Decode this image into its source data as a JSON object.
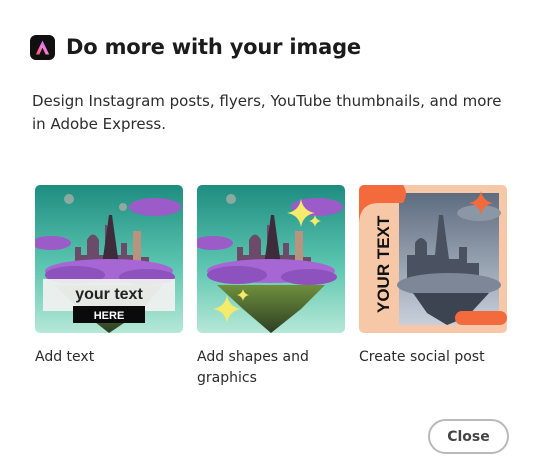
{
  "dialog": {
    "title": "Do more with your image",
    "description": "Design Instagram posts, flyers, YouTube thumbnails, and more in Adobe Express.",
    "logo_icon": "adobe-express-icon",
    "close_label": "Close"
  },
  "cards": [
    {
      "label": "Add text",
      "overlay_text_main": "your text",
      "overlay_text_tag": "HERE"
    },
    {
      "label": "Add shapes and graphics"
    },
    {
      "label": "Create social post",
      "overlay_text_main": "YOUR TEXT"
    }
  ],
  "colors": {
    "sky_top": "#2a9e8d",
    "sky_bottom": "#a9e3cf",
    "cloud_purple": "#9b5cc9",
    "star_yellow": "#f6ea6b",
    "social_orange": "#f36a3c",
    "social_peach": "#f6c8a8",
    "close_border": "#b9b9b9"
  }
}
